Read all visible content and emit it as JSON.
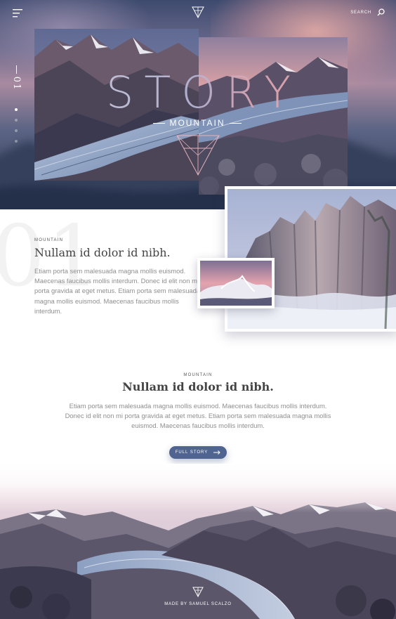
{
  "header": {
    "search_label": "SEARCH",
    "menu_icon": "hamburger-menu-icon",
    "logo_icon": "triangle-logo-icon",
    "search_icon": "search-icon"
  },
  "hero": {
    "slide_number": "01",
    "title": "STORY",
    "subtitle": "MOUNTAIN",
    "slide_dots": 4,
    "active_slide": 1
  },
  "section1": {
    "background_number": "01",
    "eyebrow": "MOUNTAIN",
    "heading": "Nullam id dolor id nibh.",
    "paragraph": "Etiam porta sem malesuada magna mollis euismod. Maecenas faucibus mollis interdum. Donec id elit non mi porta gravida at eget metus. Etiam porta sem malesuada magna mollis euismod. Maecenas faucibus mollis interdum."
  },
  "section2": {
    "eyebrow": "MOUNTAIN",
    "heading": "Nullam id dolor id nibh.",
    "paragraph": "Etiam porta sem malesuada magna mollis euismod. Maecenas faucibus mollis interdum. Donec id elit non mi porta gravida at eget metus. Etiam porta sem malesuada magna mollis euismod. Maecenas faucibus mollis interdum.",
    "button_label": "FULL STORY",
    "button_icon": "arrow-right-icon"
  },
  "footer": {
    "credit": "MADE BY SAMUEL SCALZO"
  },
  "colors": {
    "accent": "#506491",
    "text_heading": "#444444",
    "text_body": "#8f8f8f",
    "title_gradient_start": "#c9c8df",
    "title_gradient_end": "#e7aab0"
  }
}
